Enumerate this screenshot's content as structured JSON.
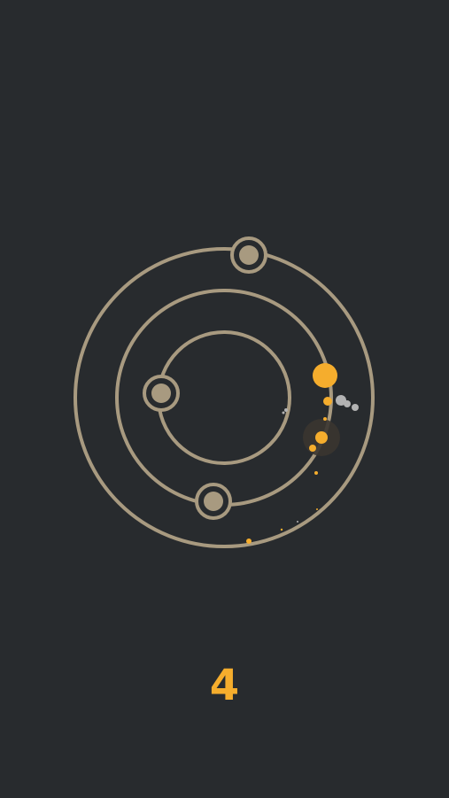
{
  "game": {
    "score": "4"
  },
  "colors": {
    "background": "#282b2e",
    "orbit": "#a89a80",
    "planet": "#a89a80",
    "player": "#f5ad2d",
    "trail": "#f5ad2d",
    "debris": "#b3b3b3"
  },
  "icons": {
    "player": "player-ball-icon",
    "planet": "planet-icon"
  }
}
